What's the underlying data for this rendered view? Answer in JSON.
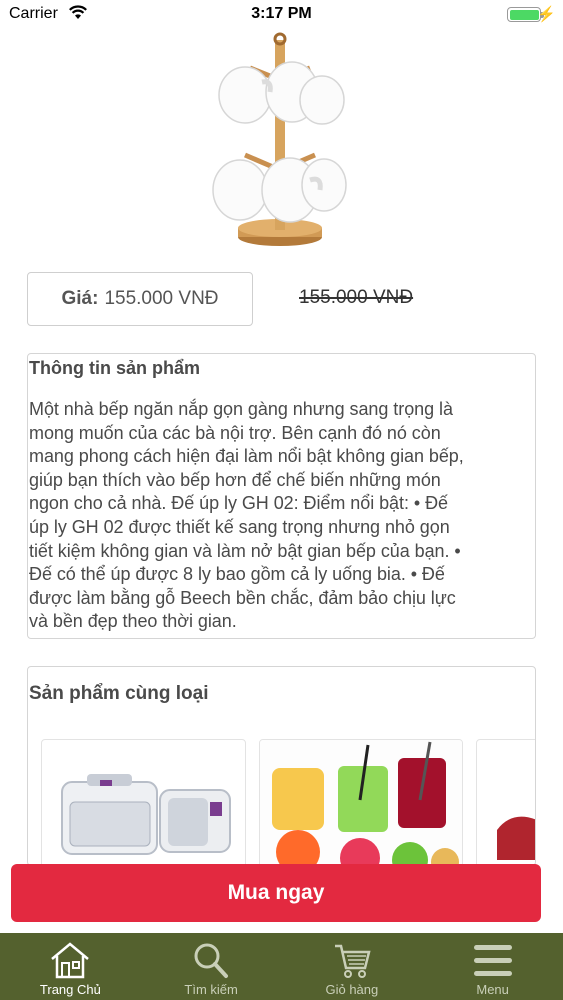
{
  "status_bar": {
    "carrier": "Carrier",
    "time": "3:17 PM",
    "battery_level": 1.0
  },
  "product": {
    "price_label": "Giá:",
    "price": "155.000 VNĐ",
    "old_price": "155.000 VNĐ",
    "info_title": "Thông tin sản phẩm",
    "info_lines": [
      "Một nhà bếp ngăn nắp gọn gàng nhưng sang trọng là",
      "mong muốn của các bà nội trợ. Bên cạnh đó nó còn",
      "mang phong cách hiện đại làm nổi bật không gian bếp,",
      "giúp bạn thích vào bếp hơn để chế biến những món",
      "ngon cho cả nhà. Đế úp ly GH 02: Điểm nổi bật: • Đế",
      "úp ly GH 02 được thiết kế sang trọng nhưng nhỏ gọn",
      "tiết kiệm không gian và làm nở bật gian bếp của bạn. •",
      "Đế có thể úp được 8 ly bao gồm cả ly uống bia. • Đế",
      "được làm bằng gỗ Beech bền chắc, đảm bảo chịu lực",
      "và bền đẹp theo thời gian."
    ]
  },
  "related": {
    "title": "Sản phẩm cùng loại"
  },
  "actions": {
    "buy_label": "Mua ngay"
  },
  "tab_bar": {
    "tabs": [
      {
        "label": "Trang Chủ",
        "icon": "home-icon",
        "active": true
      },
      {
        "label": "Tìm kiếm",
        "icon": "search-icon",
        "active": false
      },
      {
        "label": "Giỏ hàng",
        "icon": "cart-icon",
        "active": false
      },
      {
        "label": "Menu",
        "icon": "menu-icon",
        "active": false
      }
    ]
  },
  "colors": {
    "buy_button": "#e32940",
    "tab_bar": "#54612e",
    "battery": "#4cd964"
  }
}
